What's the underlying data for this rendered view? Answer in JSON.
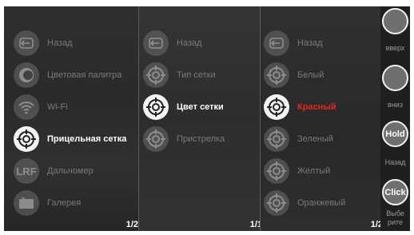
{
  "panel1": {
    "items": [
      {
        "label": "Назад",
        "icon": "back-arrow-icon"
      },
      {
        "label": "Цветовая палитра",
        "icon": "palette-icon"
      },
      {
        "label": "Wi-Fi",
        "icon": "wifi-icon"
      },
      {
        "label": "Прицельная сетка",
        "icon": "crosshair-icon"
      },
      {
        "label": "Дальномер",
        "icon": "lrf-icon",
        "icon_text": "LRF"
      },
      {
        "label": "Галерея",
        "icon": "gallery-icon"
      }
    ],
    "page": "1/2"
  },
  "panel2": {
    "items": [
      {
        "label": "Назад",
        "icon": "back-arrow-icon"
      },
      {
        "label": "Тип сетки",
        "icon": "crosshair-icon"
      },
      {
        "label": "Цвет сетки",
        "icon": "crosshair-icon"
      },
      {
        "label": "Пристрелка",
        "icon": "crosshair-icon"
      }
    ],
    "page": "1/1"
  },
  "panel3": {
    "items": [
      {
        "label": "Назад",
        "icon": "back-arrow-icon"
      },
      {
        "label": "Белый",
        "icon": "crosshair-icon"
      },
      {
        "label": "Красный",
        "icon": "crosshair-icon"
      },
      {
        "label": "Зеленый",
        "icon": "crosshair-icon"
      },
      {
        "label": "Желтый",
        "icon": "crosshair-icon"
      },
      {
        "label": "Оранжевый",
        "icon": "crosshair-icon"
      }
    ],
    "page": "1/2"
  },
  "sidebar": {
    "up_label": "вверх",
    "down_label": "вниз",
    "hold_button": "Hold",
    "hold_label": "Назад",
    "click_button": "Click",
    "click_label_1": "Выбе",
    "click_label_2": "рите"
  },
  "colors": {
    "accent_red": "#e8251e",
    "panel_bg": "#2c2c2c",
    "active_icon": "#f3f3f3"
  }
}
